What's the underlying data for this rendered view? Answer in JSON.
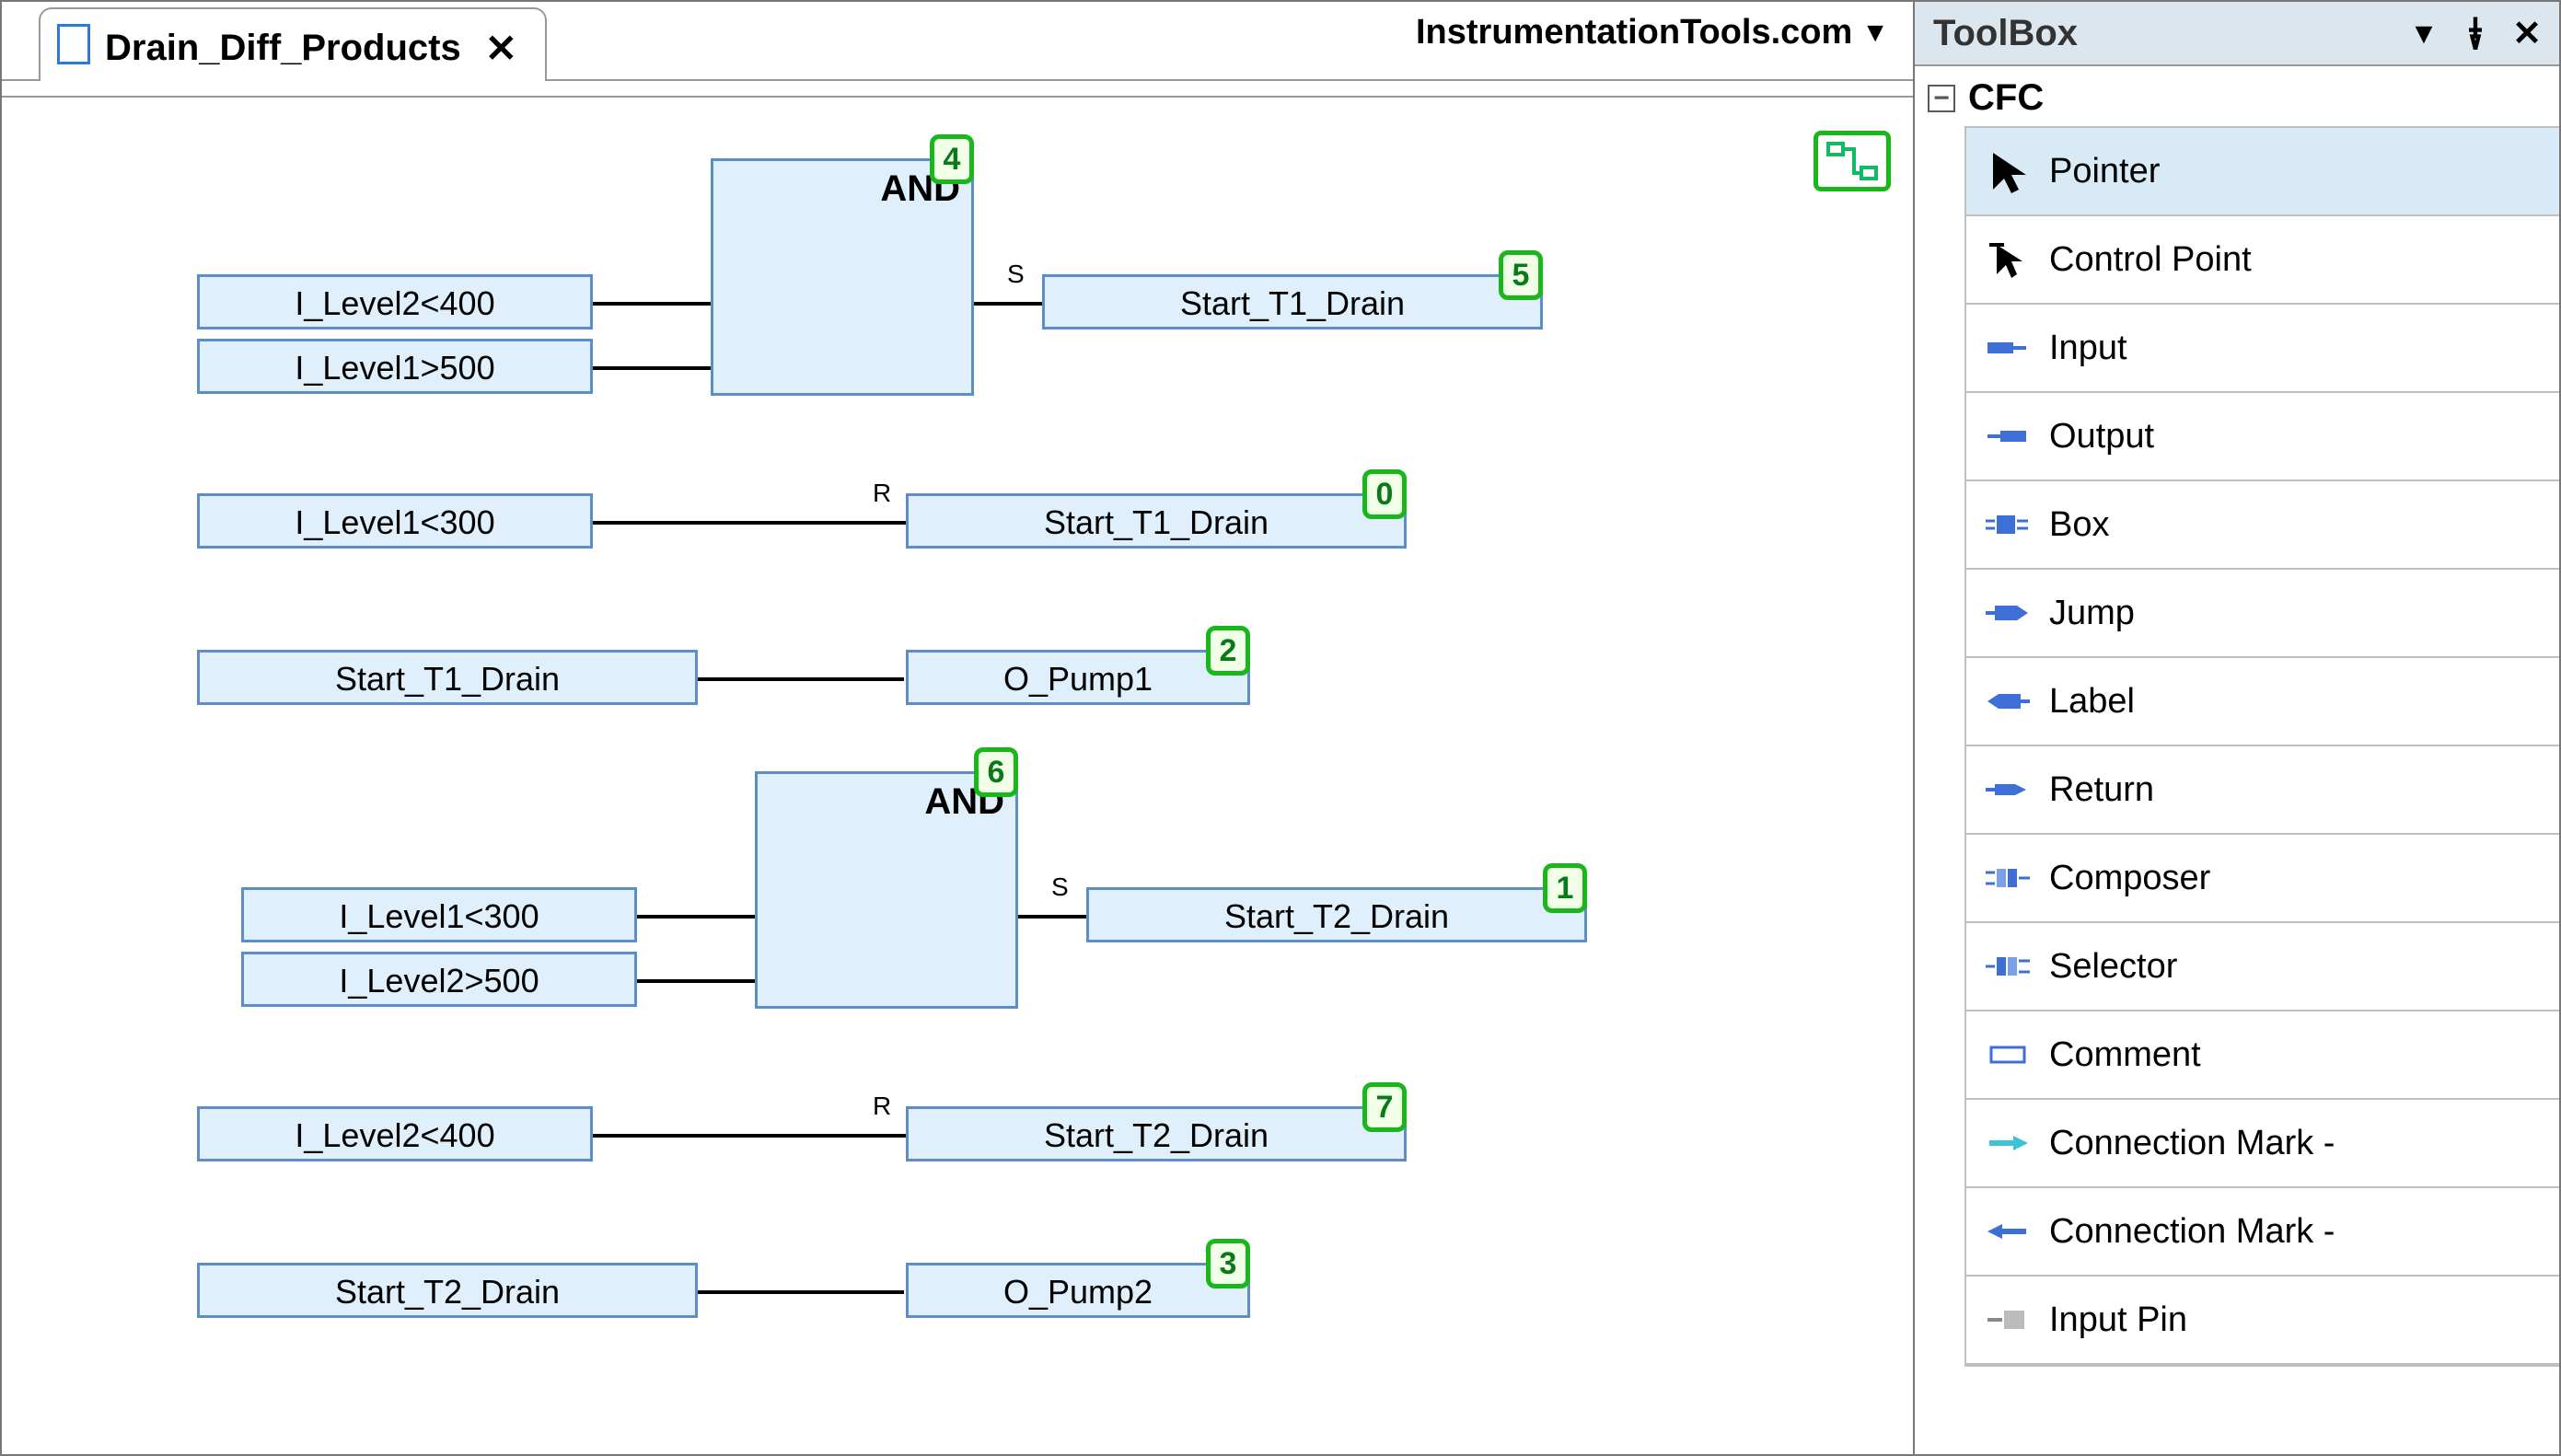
{
  "tab": {
    "title": "Drain_Diff_Products"
  },
  "watermark": "InstrumentationTools.com",
  "and_label": "AND",
  "blocks": {
    "lvl2_lt_400_a": "I_Level2<400",
    "lvl1_gt_500": "I_Level1>500",
    "start_t1_drain_set": "Start_T1_Drain",
    "lvl1_lt_300_a": "I_Level1<300",
    "start_t1_drain_rst": "Start_T1_Drain",
    "start_t1_drain_in": "Start_T1_Drain",
    "o_pump1": "O_Pump1",
    "lvl1_lt_300_b": "I_Level1<300",
    "lvl2_gt_500": "I_Level2>500",
    "start_t2_drain_set": "Start_T2_Drain",
    "lvl2_lt_400_b": "I_Level2<400",
    "start_t2_drain_rst": "Start_T2_Drain",
    "start_t2_drain_in": "Start_T2_Drain",
    "o_pump2": "O_Pump2"
  },
  "exec_order": {
    "and1": "4",
    "t1_set": "5",
    "t1_rst": "0",
    "pump1": "2",
    "and2": "6",
    "t2_set": "1",
    "t2_rst": "7",
    "pump2": "3"
  },
  "pins": {
    "s": "S",
    "r": "R"
  },
  "toolbox": {
    "title": "ToolBox",
    "category": "CFC",
    "items": [
      "Pointer",
      "Control Point",
      "Input",
      "Output",
      "Box",
      "Jump",
      "Label",
      "Return",
      "Composer",
      "Selector",
      "Comment",
      "Connection Mark - ",
      "Connection Mark - ",
      "Input Pin"
    ]
  }
}
